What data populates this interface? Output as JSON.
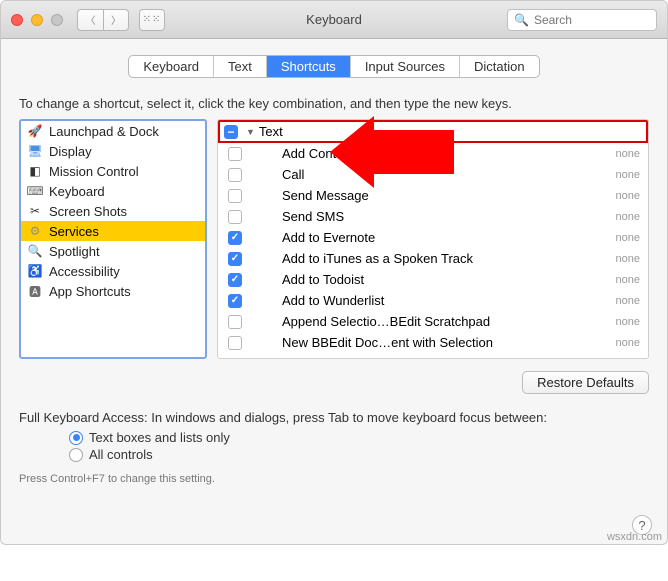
{
  "window": {
    "title": "Keyboard",
    "search_placeholder": "Search"
  },
  "tabs": [
    {
      "label": "Keyboard",
      "active": false
    },
    {
      "label": "Text",
      "active": false
    },
    {
      "label": "Shortcuts",
      "active": true
    },
    {
      "label": "Input Sources",
      "active": false
    },
    {
      "label": "Dictation",
      "active": false
    }
  ],
  "instruction": "To change a shortcut, select it, click the key combination, and then type the new keys.",
  "sidebar": {
    "items": [
      {
        "label": "Launchpad & Dock",
        "icon": "launchpad-icon",
        "color": "#6e6e6e"
      },
      {
        "label": "Display",
        "icon": "display-icon",
        "color": "#4a90e2"
      },
      {
        "label": "Mission Control",
        "icon": "mission-control-icon",
        "color": "#333333"
      },
      {
        "label": "Keyboard",
        "icon": "keyboard-icon",
        "color": "#6e6e6e"
      },
      {
        "label": "Screen Shots",
        "icon": "screenshots-icon",
        "color": "#333333"
      },
      {
        "label": "Services",
        "icon": "services-icon",
        "color": "#8e8e8e",
        "selected": true
      },
      {
        "label": "Spotlight",
        "icon": "spotlight-icon",
        "color": "#1e90ff"
      },
      {
        "label": "Accessibility",
        "icon": "accessibility-icon",
        "color": "#1e90ff"
      },
      {
        "label": "App Shortcuts",
        "icon": "app-shortcuts-icon",
        "color": "#6e6e6e"
      }
    ]
  },
  "detail": {
    "group_name": "Text",
    "services": [
      {
        "name": "Add Contact",
        "enabled": false,
        "shortcut": "none"
      },
      {
        "name": "Call",
        "enabled": false,
        "shortcut": "none"
      },
      {
        "name": "Send Message",
        "enabled": false,
        "shortcut": "none"
      },
      {
        "name": "Send SMS",
        "enabled": false,
        "shortcut": "none"
      },
      {
        "name": "Add to Evernote",
        "enabled": true,
        "shortcut": "none"
      },
      {
        "name": "Add to iTunes as a Spoken Track",
        "enabled": true,
        "shortcut": "none"
      },
      {
        "name": "Add to Todoist",
        "enabled": true,
        "shortcut": "none"
      },
      {
        "name": "Add to Wunderlist",
        "enabled": true,
        "shortcut": "none"
      },
      {
        "name": "Append Selectio…BEdit Scratchpad",
        "enabled": false,
        "shortcut": "none"
      },
      {
        "name": "New BBEdit Doc…ent with Selection",
        "enabled": false,
        "shortcut": "none"
      }
    ]
  },
  "restore_label": "Restore Defaults",
  "fka": {
    "text": "Full Keyboard Access: In windows and dialogs, press Tab to move keyboard focus between:",
    "options": [
      {
        "label": "Text boxes and lists only",
        "selected": true
      },
      {
        "label": "All controls",
        "selected": false
      }
    ],
    "hint": "Press Control+F7 to change this setting."
  },
  "help_label": "?",
  "watermark": "wsxdn.com"
}
